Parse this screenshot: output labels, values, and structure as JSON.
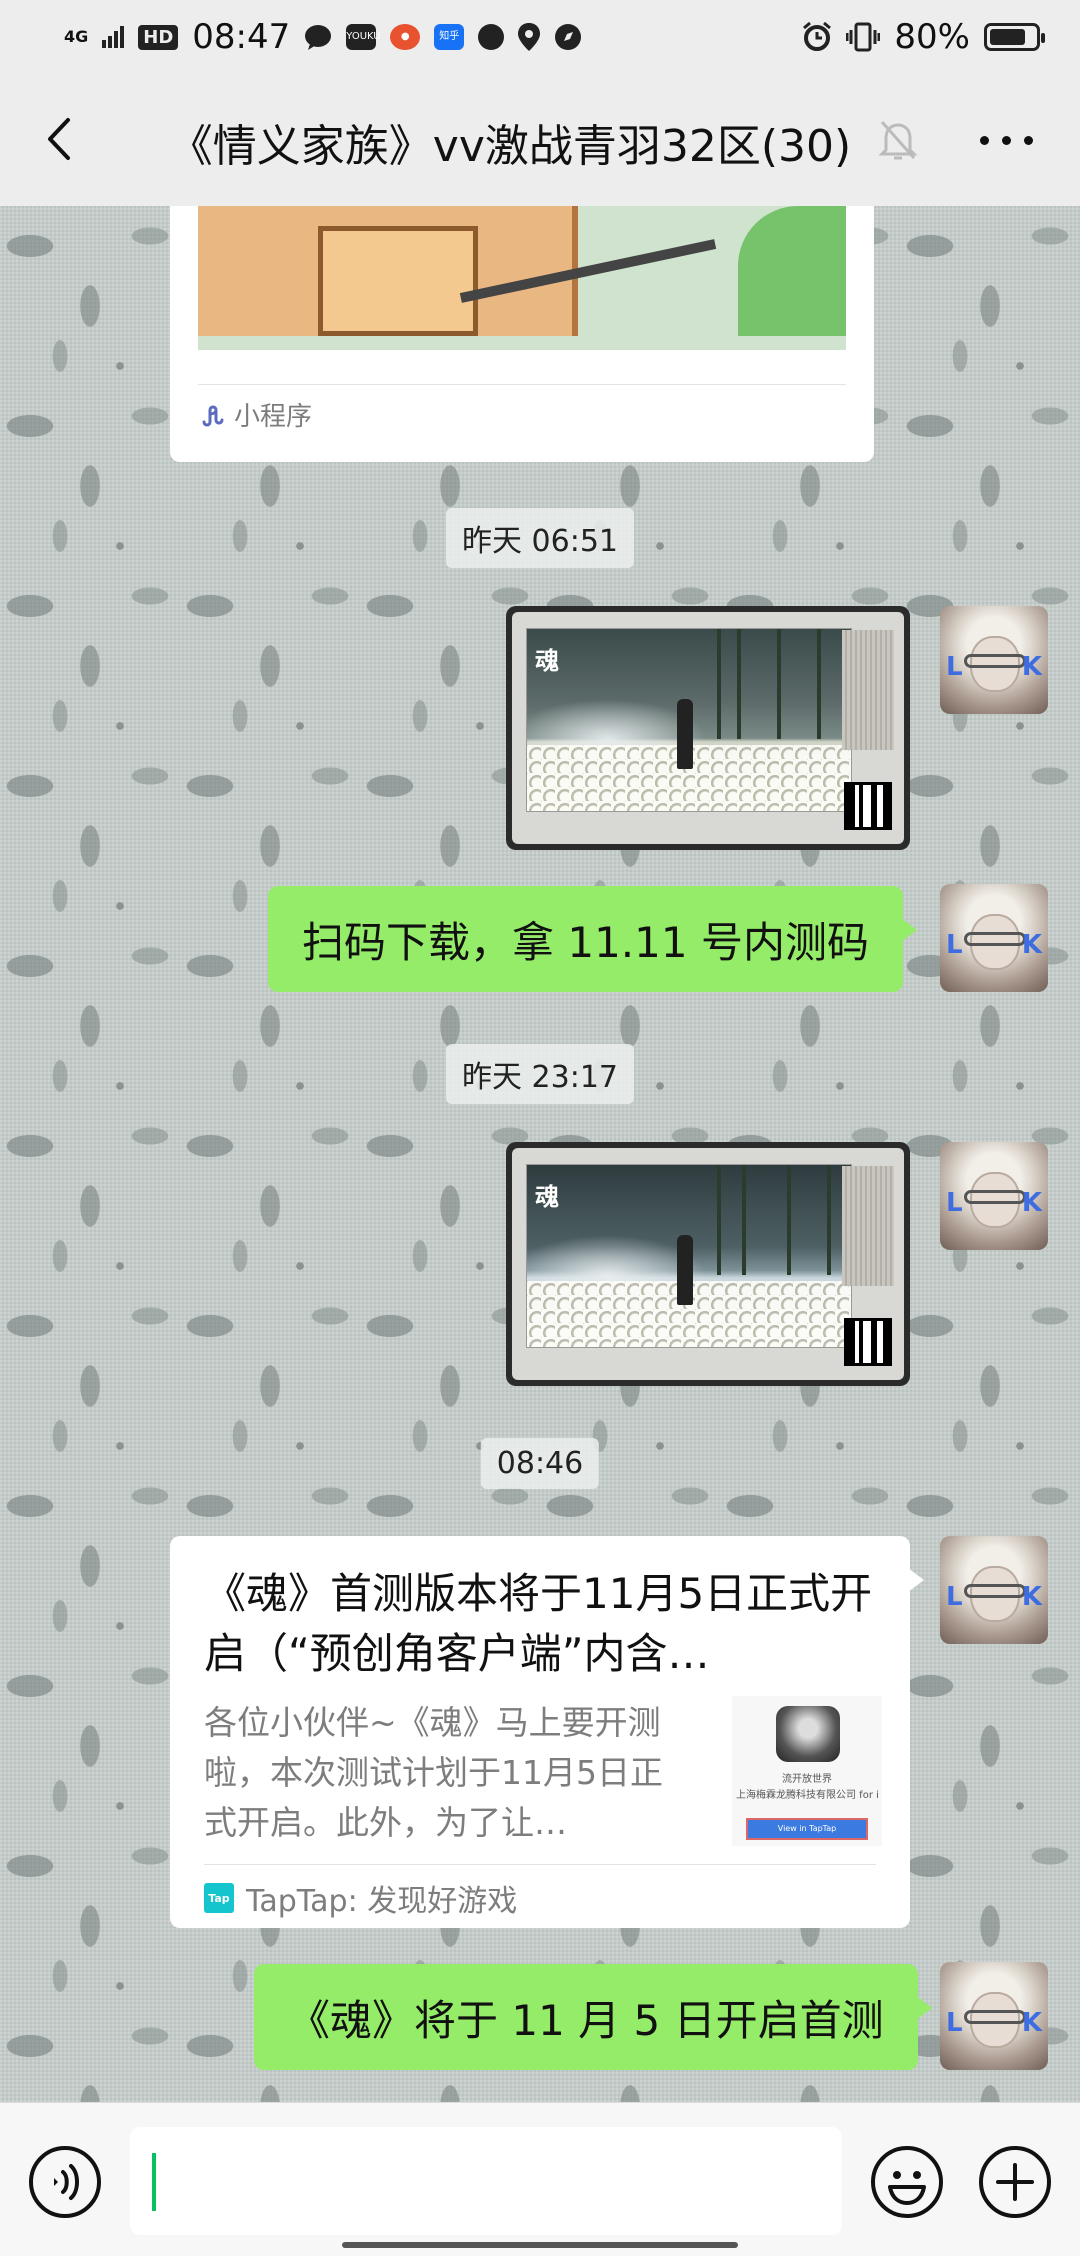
{
  "status_bar": {
    "network": "4G",
    "hd": "HD",
    "time": "08:47",
    "battery": "80%",
    "battery_level": 0.8,
    "icons": [
      "signal-icon",
      "hd-icon",
      "chat-bubble-icon",
      "youku-icon",
      "taobao-icon",
      "zhihu-icon",
      "du-icon",
      "location-icon",
      "compass-icon",
      "alarm-icon",
      "vibrate-icon",
      "battery-icon"
    ]
  },
  "nav": {
    "title": "《情义家族》vv激战青羽32区(30)",
    "back_icon": "chevron-left-icon",
    "mute_icon": "bell-muted-icon",
    "more_icon": "more-horizontal-icon"
  },
  "messages": {
    "mini_program": {
      "footer": "小程序"
    },
    "time1": "昨天 06:51",
    "text1": "扫码下载，拿 11.11 号内测码",
    "time2": "昨天 23:17",
    "time3": "08:46",
    "link": {
      "title": "《魂》首测版本将于11月5日正式开启（“预创角客户端”内含…",
      "desc": "各位小伙伴~《魂》马上要开测啦，本次测试计划于11月5日正式开启。此外，为了让…",
      "source": "TapTap: 发现好游戏",
      "source_icon": "Tap",
      "thumb_line1": "流开放世界",
      "thumb_line2": "上海梅霖龙腾科技有限公司 for il",
      "thumb_btn": "View in TapTap"
    },
    "text2": "《魂》将于 11 月 5 日开启首测"
  },
  "input_bar": {
    "voice_icon": "voice-icon",
    "emoji_icon": "emoji-icon",
    "plus_icon": "plus-circle-icon",
    "input_value": ""
  },
  "colors": {
    "green_bubble": "#95ec69",
    "bar_bg": "#ededed",
    "caret": "#07c160"
  }
}
